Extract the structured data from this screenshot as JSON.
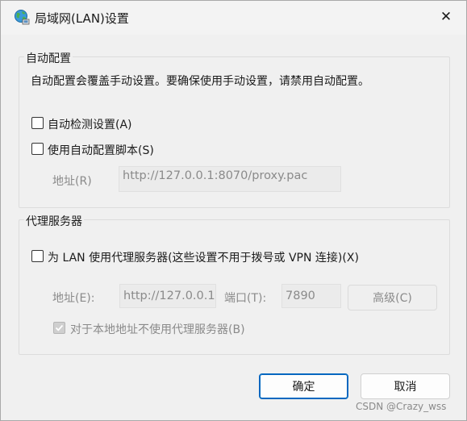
{
  "window": {
    "title": "局域网(LAN)设置",
    "icon": "network-globe-icon",
    "close_glyph": "✕"
  },
  "auto_config": {
    "group_title": "自动配置",
    "description": "自动配置会覆盖手动设置。要确保使用手动设置，请禁用自动配置。",
    "auto_detect_label": "自动检测设置(A)",
    "auto_detect_checked": false,
    "use_script_label": "使用自动配置脚本(S)",
    "use_script_checked": false,
    "address_label": "地址(R)",
    "address_value": "http://127.0.0.1:8070/proxy.pac"
  },
  "proxy": {
    "group_title": "代理服务器",
    "use_proxy_label": "为 LAN 使用代理服务器(这些设置不用于拨号或 VPN 连接)(X)",
    "use_proxy_checked": false,
    "address_label": "地址(E):",
    "address_value": "http://127.0.0.1",
    "port_label": "端口(T):",
    "port_value": "7890",
    "advanced_label": "高级(C)",
    "bypass_local_label": "对于本地地址不使用代理服务器(B)",
    "bypass_local_checked": true
  },
  "buttons": {
    "ok_label": "确定",
    "cancel_label": "取消"
  },
  "watermark": "CSDN @Crazy_wss",
  "colors": {
    "accent": "#0067c0",
    "window_bg": "#f0f0f0",
    "disabled_text": "#8a8a8a"
  }
}
